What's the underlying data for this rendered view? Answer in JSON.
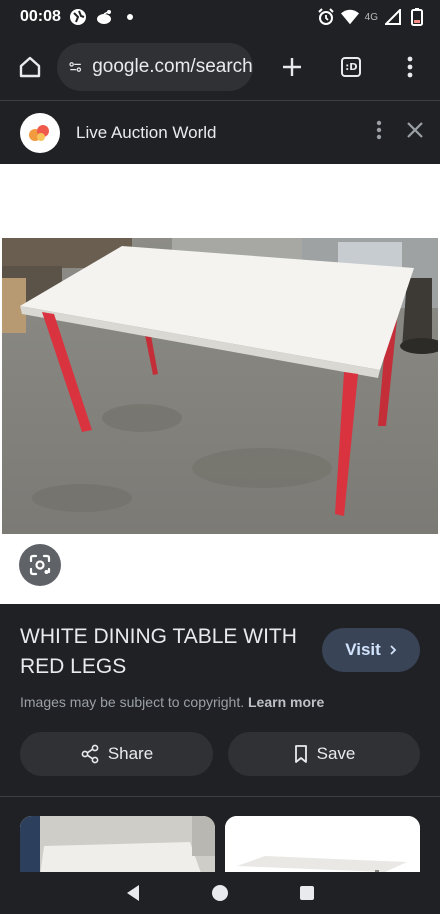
{
  "status": {
    "time": "00:08",
    "network": "4G"
  },
  "browser": {
    "url": "google.com/search",
    "tab_count": ":D"
  },
  "source": {
    "name": "Live Auction World"
  },
  "result": {
    "title": "WHITE DINING TABLE WITH RED LEGS",
    "visit_label": "Visit",
    "copyright_text": "Images may be subject to copyright.",
    "learn_more": "Learn more",
    "share_label": "Share",
    "save_label": "Save"
  },
  "colors": {
    "background": "#202124",
    "visit_button": "#394457",
    "table_legs": "#d9333f",
    "table_top": "#f4f3ef"
  }
}
